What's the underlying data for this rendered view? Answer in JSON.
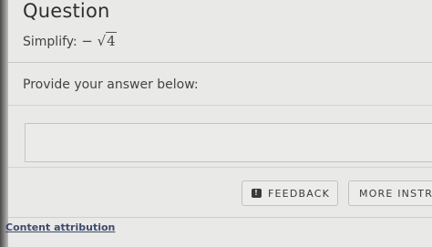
{
  "question": {
    "heading": "Question",
    "prompt_label": "Simplify: ",
    "prompt_sign": "−",
    "radical_symbol": "√",
    "radicand": "4"
  },
  "answer": {
    "label": "Provide your answer below:",
    "value": ""
  },
  "buttons": {
    "feedback_icon": "!",
    "feedback_label": "FEEDBACK",
    "more_label": "MORE INSTRU"
  },
  "footer": {
    "attribution_link": "Content attribution"
  },
  "colors": {
    "background": "#e9e9e8",
    "text": "#3b3b3b",
    "link": "#3e4a6b"
  }
}
